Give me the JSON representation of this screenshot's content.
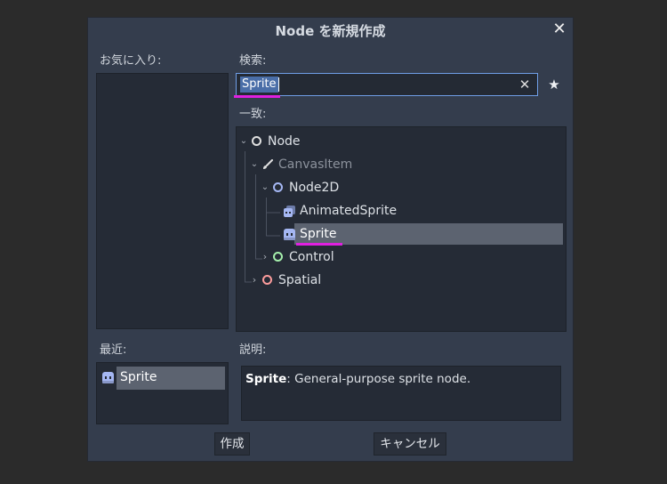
{
  "dialog": {
    "title": "Node を新規作成",
    "close_glyph": "✕"
  },
  "favorites": {
    "label": "お気に入り:"
  },
  "search": {
    "label": "検索:",
    "value": "Sprite",
    "clear_glyph": "✕",
    "favorite_glyph": "★"
  },
  "matches": {
    "label": "一致:",
    "tree": [
      {
        "label": "Node",
        "icon": "circle-icon",
        "color": "#e0e0e0",
        "expanded": true
      },
      {
        "label": "CanvasItem",
        "icon": "brush-icon",
        "color": "#e0e0e0",
        "expanded": true,
        "dimmed": true
      },
      {
        "label": "Node2D",
        "icon": "circle-icon",
        "color": "#a5b7f3",
        "expanded": true
      },
      {
        "label": "AnimatedSprite",
        "icon": "animated-sprite-icon",
        "color": "#a5b7f3"
      },
      {
        "label": "Sprite",
        "icon": "sprite-icon",
        "color": "#a5b7f3",
        "selected": true
      },
      {
        "label": "Control",
        "icon": "circle-icon",
        "color": "#a5efac",
        "expanded": false
      },
      {
        "label": "Spatial",
        "icon": "circle-icon",
        "color": "#fc9c9c",
        "expanded": false
      }
    ]
  },
  "recent": {
    "label": "最近:",
    "items": [
      {
        "label": "Sprite",
        "icon": "sprite-icon",
        "selected": true
      }
    ]
  },
  "description": {
    "label": "説明:",
    "name": "Sprite",
    "text": ": General-purpose sprite node."
  },
  "buttons": {
    "create": "作成",
    "cancel": "キャンセル"
  },
  "colors": {
    "accent": "#6f9ee6",
    "highlight": "#e020e0",
    "node2d": "#a5b7f3",
    "control": "#a5efac",
    "spatial": "#fc9c9c"
  }
}
